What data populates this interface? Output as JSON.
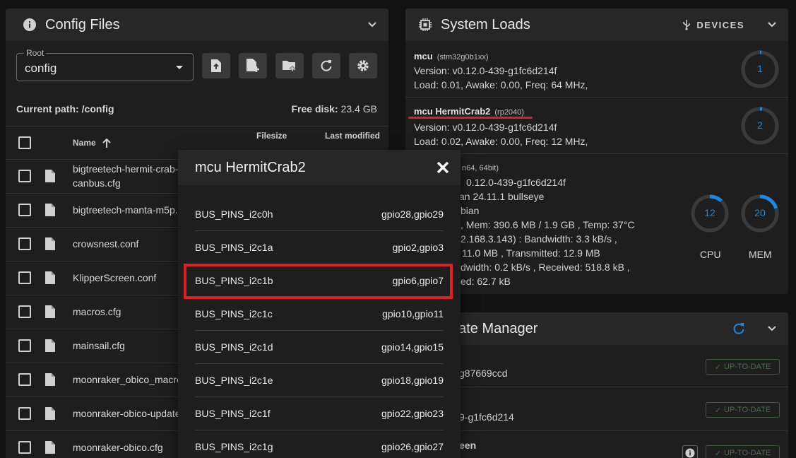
{
  "config": {
    "title": "Config Files",
    "root_label": "Root",
    "root_value": "config",
    "current_path_label": "Current path:",
    "current_path": "/config",
    "free_disk_label": "Free disk:",
    "free_disk": "23.4 GB",
    "columns": {
      "name": "Name",
      "filesize": "Filesize",
      "last_modified": "Last modified"
    },
    "files": [
      {
        "name": "bigtreetech-hermit-crab-",
        "name2": "canbus.cfg"
      },
      {
        "name": "bigtreetech-manta-m5p."
      },
      {
        "name": "crowsnest.conf"
      },
      {
        "name": "KlipperScreen.conf"
      },
      {
        "name": "macros.cfg"
      },
      {
        "name": "mainsail.cfg"
      },
      {
        "name": "moonraker_obico_macro"
      },
      {
        "name": "moonraker-obico-update"
      },
      {
        "name": "moonraker-obico.cfg"
      }
    ]
  },
  "loads": {
    "title": "System Loads",
    "devices_label": "DEVICES",
    "mcus": [
      {
        "name": "mcu",
        "chip": "(stm32g0b1xx)",
        "version": "Version: v0.12.0-439-g1fc6d214f",
        "load": "Load: 0.01, Awake: 0.00, Freq: 64 MHz,",
        "gauge": "1"
      },
      {
        "name": "mcu HermitCrab2",
        "chip": "(rp2040)",
        "version": "Version: v0.12.0-439-g1fc6d214f",
        "load": "Load: 0.02, Awake: 0.00, Freq: 12 MHz,",
        "gauge": "2"
      }
    ],
    "host": {
      "chip": "n64, 64bit)",
      "lines": [
        "0.12.0-439-g1fc6d214f",
        "an 24.11.1 bullseye",
        "bian",
        ", Mem: 390.6 MB / 1.9 GB , Temp: 37°C",
        "2.168.3.143) : Bandwidth: 3.3 kB/s ,",
        "11.0 MB , Transmitted: 12.9 MB",
        "dwidth: 0.2 kB/s , Received: 518.8 kB ,",
        "ed: 62.7 kB"
      ],
      "cpu_value": "12",
      "cpu_label": "CPU",
      "mem_value": "20",
      "mem_label": "MEM"
    }
  },
  "update": {
    "title": "date Manager",
    "items": [
      {
        "text": "g87669ccd",
        "badge": "UP-TO-DATE"
      },
      {
        "text": "9-g1fc6d214",
        "badge": "UP-TO-DATE"
      },
      {
        "text": "een",
        "badge": "UP-TO-DATE"
      }
    ]
  },
  "modal": {
    "title": "mcu HermitCrab2",
    "rows": [
      {
        "key": "BUS_PINS_i2c0h",
        "value": "gpio28,gpio29"
      },
      {
        "key": "BUS_PINS_i2c1a",
        "value": "gpio2,gpio3"
      },
      {
        "key": "BUS_PINS_i2c1b",
        "value": "gpio6,gpio7"
      },
      {
        "key": "BUS_PINS_i2c1c",
        "value": "gpio10,gpio11"
      },
      {
        "key": "BUS_PINS_i2c1d",
        "value": "gpio14,gpio15"
      },
      {
        "key": "BUS_PINS_i2c1e",
        "value": "gpio18,gpio19"
      },
      {
        "key": "BUS_PINS_i2c1f",
        "value": "gpio22,gpio23"
      },
      {
        "key": "BUS_PINS_i2c1g",
        "value": "gpio26,gpio27"
      }
    ]
  },
  "colors": {
    "accent": "#1e88e5",
    "highlight": "#e02020",
    "badge": "#4c6c4c"
  }
}
